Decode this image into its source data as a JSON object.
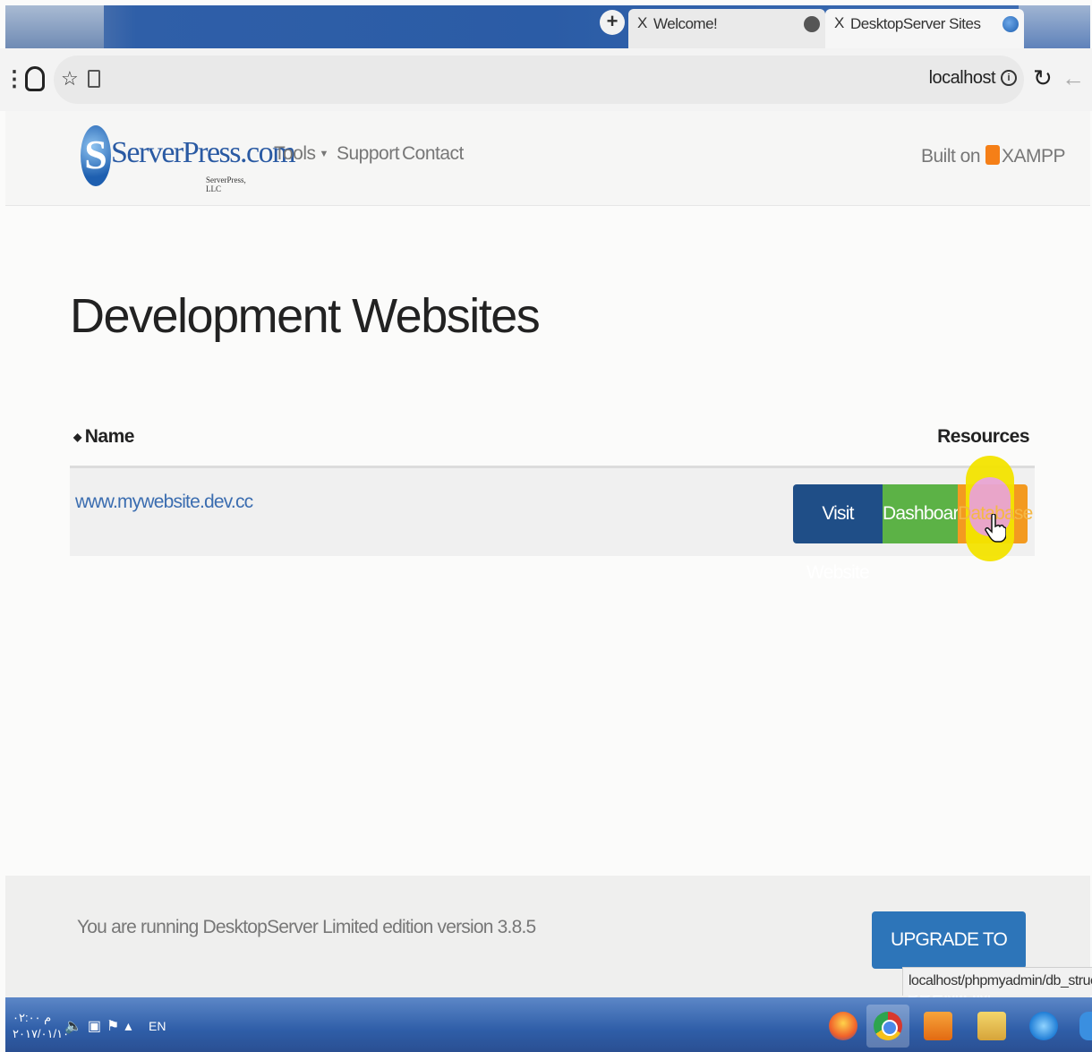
{
  "browser": {
    "new_tab_symbol": "+",
    "tabs": [
      {
        "close": "X",
        "title": "Welcome!"
      },
      {
        "close": "X",
        "title": "DesktopServer Sites"
      }
    ],
    "url": "localhost",
    "info_symbol": "i"
  },
  "header": {
    "logo_text": "ServerPress.com",
    "logo_letter": "S",
    "logo_sub": "ServerPress, LLC",
    "nav": {
      "tools": "Tools",
      "support": "Support",
      "contact": "Contact"
    },
    "built_on_label": "Built on",
    "built_on_product": "XAMPP"
  },
  "main": {
    "title": "Development Websites",
    "columns": {
      "name": "Name",
      "resources": "Resources"
    },
    "sites": [
      {
        "name": "www.mywebsite.dev.cc",
        "actions": {
          "visit": "Visit Website",
          "dashboard": "Dashboard",
          "database": "Database"
        }
      }
    ]
  },
  "footer": {
    "version_text": "You are running DesktopServer Limited edition version 3.8.5",
    "upgrade_label": "UPGRADE TO PREMIUM"
  },
  "status_url": "localhost/phpmyadmin/db_structure.php?",
  "taskbar": {
    "time": "۰۲:۰۰ م",
    "date": "۲۰۱۷/۰۱/۱۰",
    "language": "EN"
  },
  "colors": {
    "visit": "#1f4e87",
    "dashboard": "#5cb246",
    "database": "#f39a20",
    "upgrade": "#2d75b9",
    "link": "#3b6db0"
  }
}
